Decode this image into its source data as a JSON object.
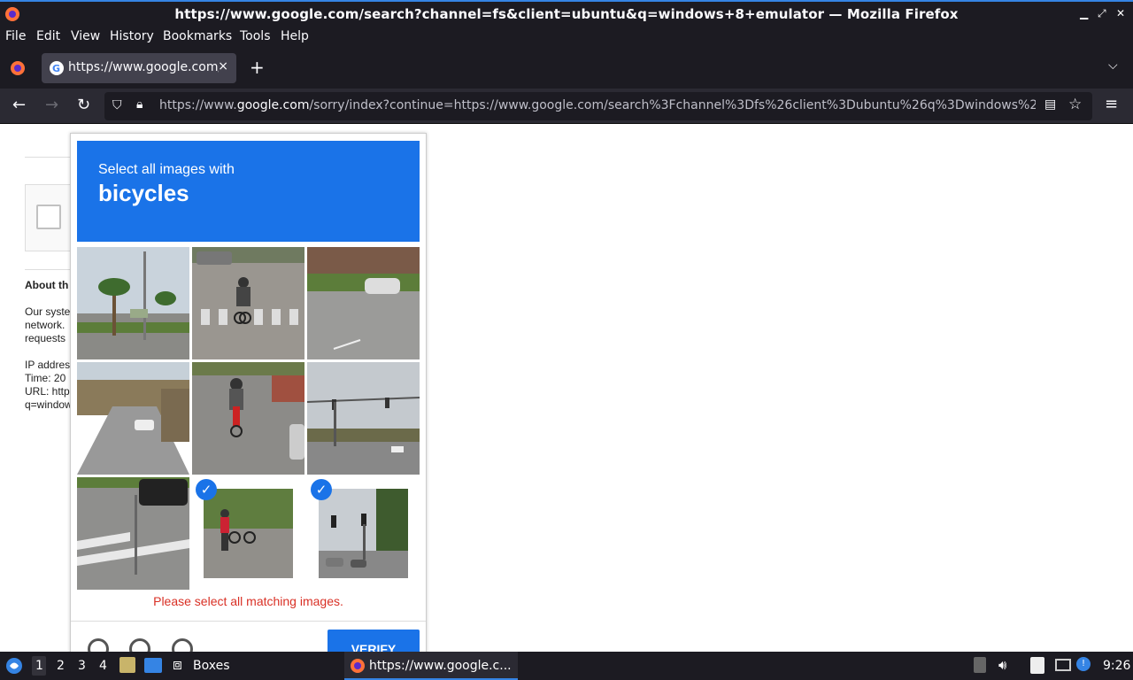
{
  "window": {
    "title": "https://www.google.com/search?channel=fs&client=ubuntu&q=windows+8+emulator — Mozilla Firefox"
  },
  "menu": [
    "File",
    "Edit",
    "View",
    "History",
    "Bookmarks",
    "Tools",
    "Help"
  ],
  "tab": {
    "label": "https://www.google.com/sorry/index?continue",
    "close": "×",
    "new": "+"
  },
  "url": {
    "prefix": "https://www.",
    "domain": "google.com",
    "rest": "/sorry/index?continue=https://www.google.com/search%3Fchannel%3Dfs%26client%3Dubuntu%26q%3Dwindows%2"
  },
  "page": {
    "about": "About th",
    "para": [
      "Our syste",
      "network.",
      "requests"
    ],
    "info": [
      "IP addres",
      "Time: 20",
      "URL: http",
      "q=window"
    ]
  },
  "captcha": {
    "line1": "Select all images with",
    "keyword": "bicycles",
    "error": "Please select all matching images.",
    "verify": "VERIFY",
    "selected": [
      7,
      8
    ]
  },
  "taskbar": {
    "workspaces": [
      "1",
      "2",
      "3",
      "4"
    ],
    "app": "Boxes",
    "window": "https://www.google.c...",
    "clock": "9:26"
  },
  "colors": {
    "accent": "#1a73e8",
    "error": "#d93025",
    "chrome": "#1c1b22"
  }
}
